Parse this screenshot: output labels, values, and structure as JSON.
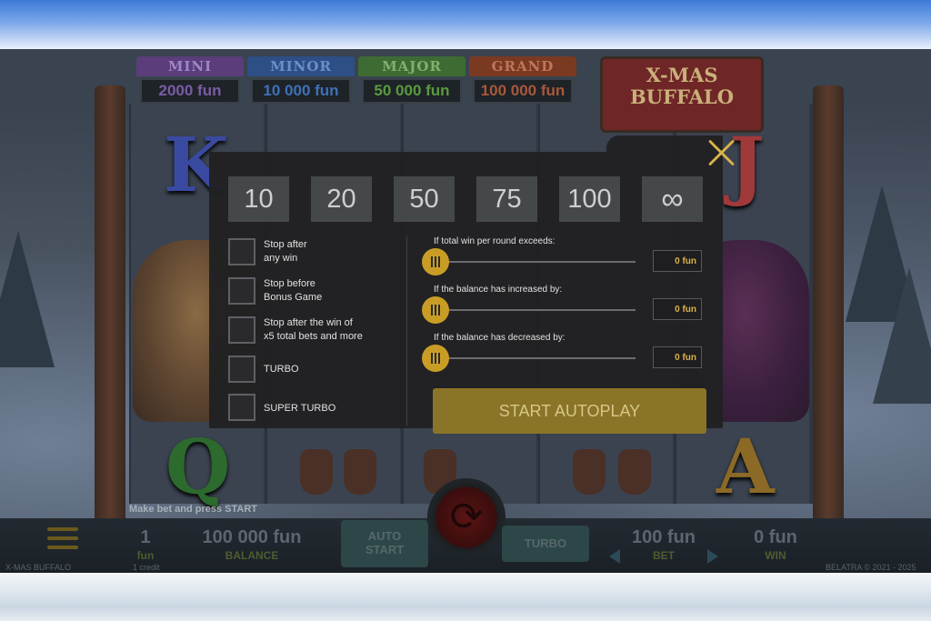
{
  "jackpots": [
    {
      "name": "MINI",
      "value": "2000 fun",
      "name_bg": "#5a3d7a",
      "value_color": "#7b5ba6"
    },
    {
      "name": "MINOR",
      "value": "10 000 fun",
      "name_bg": "#2e4e86",
      "value_color": "#3f70b8"
    },
    {
      "name": "MAJOR",
      "value": "50 000 fun",
      "name_bg": "#3e6b34",
      "value_color": "#5a9a3f"
    },
    {
      "name": "GRAND",
      "value": "100 000 fun",
      "name_bg": "#7a3a22",
      "value_color": "#a8583a"
    }
  ],
  "logo": {
    "line1": "X-MAS",
    "line2": "BUFFALO"
  },
  "symbols": {
    "k": "K",
    "j": "J",
    "q": "Q",
    "a": "A"
  },
  "modal": {
    "counts": [
      "10",
      "20",
      "50",
      "75",
      "100",
      "∞"
    ],
    "checkboxes": [
      {
        "label": "Stop after\nany win"
      },
      {
        "label": "Stop before\nBonus Game"
      },
      {
        "label": "Stop after the win of\nx5 total bets and more"
      },
      {
        "label": "TURBO"
      },
      {
        "label": "SUPER TURBO"
      }
    ],
    "sliders": [
      {
        "title": "If total win per round exceeds:",
        "value": "0 fun",
        "level": 0
      },
      {
        "title": "If the balance has increased by:",
        "value": "0 fun",
        "level": 0
      },
      {
        "title": "If the balance has decreased by:",
        "value": "0 fun",
        "level": 0
      }
    ],
    "start_label": "START AUTOPLAY"
  },
  "hint": "Make bet and press START",
  "bottom": {
    "lines_value": "1",
    "lines_label": "fun",
    "credit_text": "1 credit",
    "balance_value": "100 000 fun",
    "balance_label": "BALANCE",
    "auto_label_1": "AUTO",
    "auto_label_2": "START",
    "turbo_label": "TURBO",
    "bet_value": "100 fun",
    "bet_label": "BET",
    "win_value": "0 fun",
    "win_label": "WIN",
    "game_name": "X-MAS BUFFALO",
    "copyright": "BELATRA © 2021 - 2025"
  },
  "colors": {
    "accent": "#c99d25",
    "button_bg": "#8a7427",
    "close": "#d9b24a"
  }
}
